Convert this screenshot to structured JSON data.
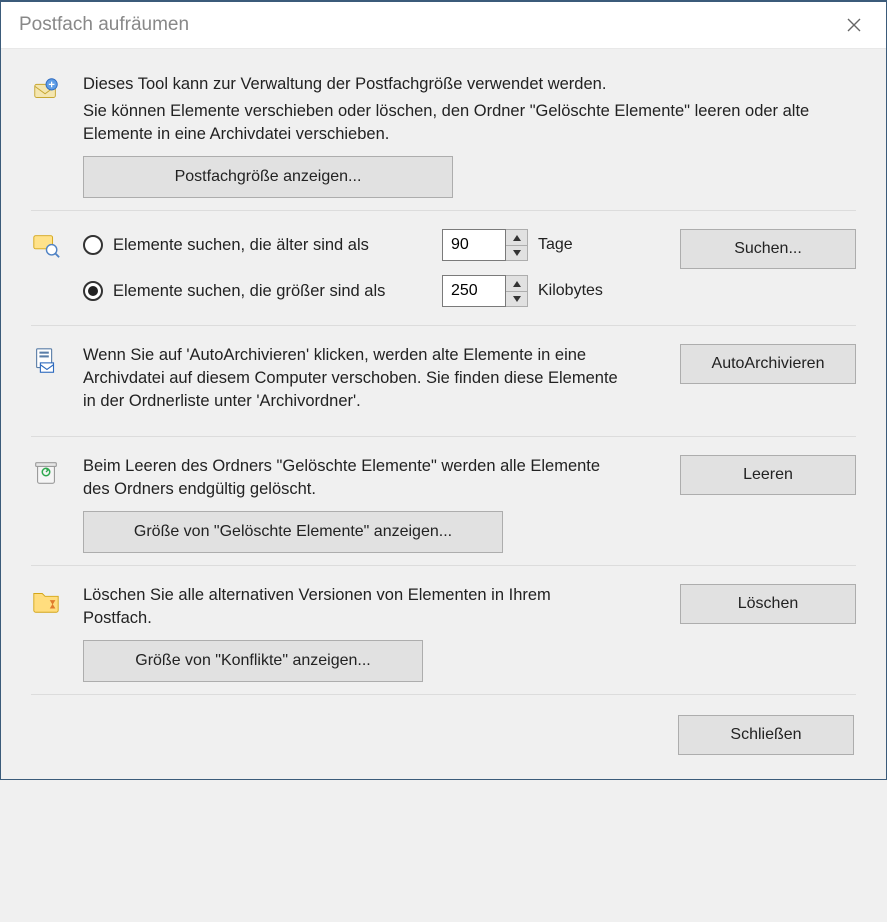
{
  "title": "Postfach aufräumen",
  "section_intro": {
    "line1": "Dieses Tool kann zur Verwaltung der Postfachgröße verwendet werden.",
    "line2": "Sie können Elemente verschieben oder löschen, den Ordner \"Gelöschte Elemente\" leeren oder alte Elemente in eine Archivdatei verschieben.",
    "button": "Postfachgröße anzeigen..."
  },
  "section_find": {
    "radio_older_label": "Elemente suchen, die älter sind als",
    "radio_larger_label": "Elemente suchen, die größer sind als",
    "selected": "larger",
    "older_value": "90",
    "older_unit": "Tage",
    "larger_value": "250",
    "larger_unit": "Kilobytes",
    "button": "Suchen..."
  },
  "section_autoarchive": {
    "desc": "Wenn Sie auf 'AutoArchivieren' klicken, werden alte Elemente in eine Archivdatei auf diesem Computer verschoben. Sie finden diese Elemente in der Ordnerliste unter 'Archivordner'.",
    "button": "AutoArchivieren"
  },
  "section_deleted": {
    "desc": "Beim Leeren des Ordners \"Gelöschte Elemente\" werden alle Elemente des Ordners endgültig gelöscht.",
    "button": "Leeren",
    "size_button": "Größe von \"Gelöschte Elemente\" anzeigen..."
  },
  "section_conflicts": {
    "desc": "Löschen Sie alle alternativen Versionen von Elementen in Ihrem Postfach.",
    "button": "Löschen",
    "size_button": "Größe von \"Konflikte\" anzeigen..."
  },
  "footer": {
    "close": "Schließen"
  }
}
